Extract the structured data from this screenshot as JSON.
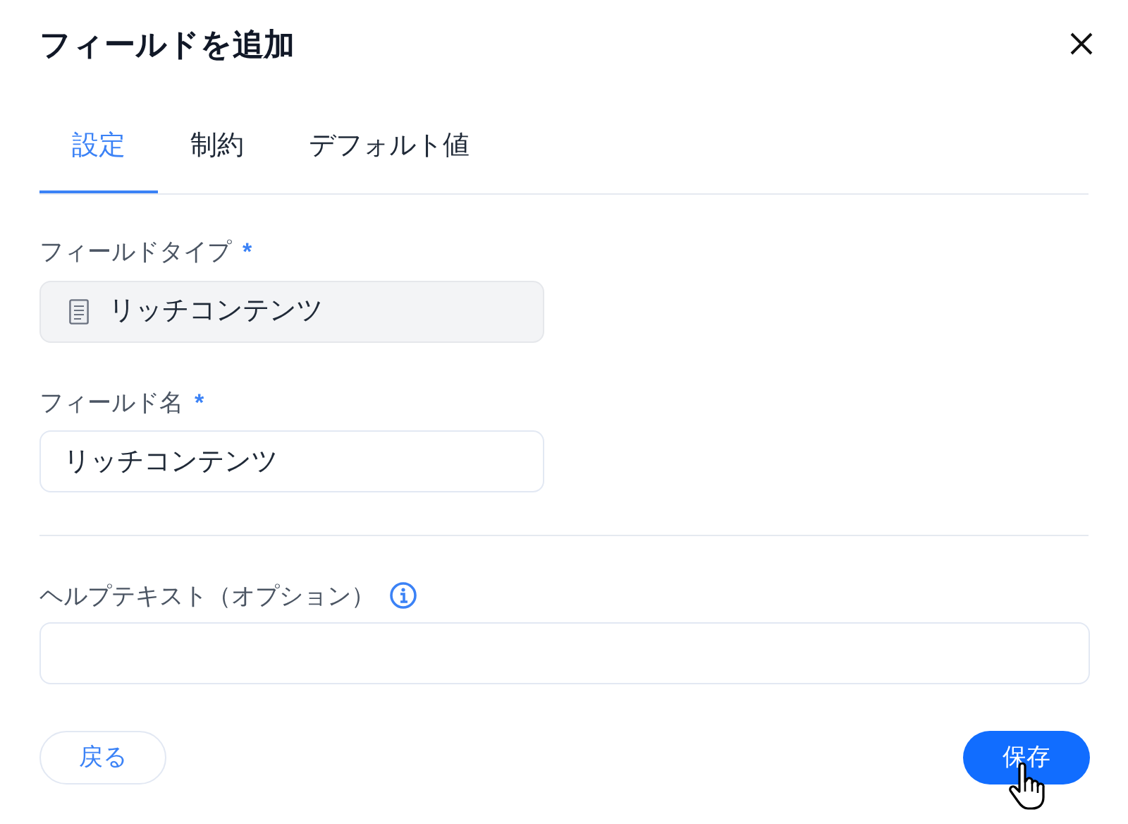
{
  "dialog": {
    "title": "フィールドを追加"
  },
  "tabs": [
    {
      "label": "設定",
      "selected": true
    },
    {
      "label": "制約",
      "selected": false
    },
    {
      "label": "デフォルト値",
      "selected": false
    }
  ],
  "field_type": {
    "label": "フィールドタイプ",
    "required_mark": "*",
    "value": "リッチコンテンツ",
    "disabled": true
  },
  "field_name": {
    "label": "フィールド名",
    "required_mark": "*",
    "value": "リッチコンテンツ"
  },
  "help_text": {
    "label": "ヘルプテキスト（オプション）"
  },
  "buttons": {
    "back": "戻る",
    "save": "保存"
  }
}
